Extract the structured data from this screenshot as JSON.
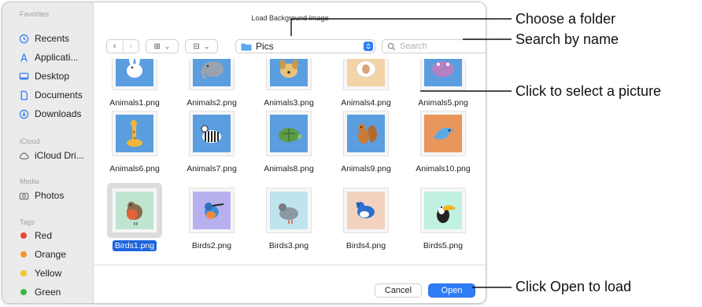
{
  "dialog": {
    "title": "Load Background Image",
    "sidebar": {
      "favorites_heading": "Favorites",
      "favorites": [
        {
          "label": "Recents",
          "icon": "clock-icon"
        },
        {
          "label": "Applicati...",
          "icon": "apps-icon"
        },
        {
          "label": "Desktop",
          "icon": "desktop-icon"
        },
        {
          "label": "Documents",
          "icon": "document-icon"
        },
        {
          "label": "Downloads",
          "icon": "download-icon"
        }
      ],
      "icloud_heading": "iCloud",
      "icloud": [
        {
          "label": "iCloud Dri...",
          "icon": "cloud-icon"
        }
      ],
      "media_heading": "Media",
      "media": [
        {
          "label": "Photos",
          "icon": "camera-icon"
        }
      ],
      "tags_heading": "Tags",
      "tags": [
        {
          "label": "Red",
          "color": "#e8483c"
        },
        {
          "label": "Orange",
          "color": "#f0952a"
        },
        {
          "label": "Yellow",
          "color": "#f3c823"
        },
        {
          "label": "Green",
          "color": "#3bb54a"
        }
      ]
    },
    "toolbar": {
      "location": "Pics",
      "search_placeholder": "Search"
    },
    "files": [
      {
        "name": "Animals1.png",
        "bg": "#5b9ee0",
        "icon": "rabbit-icon"
      },
      {
        "name": "Animals2.png",
        "bg": "#5b9ee0",
        "icon": "elephant-icon"
      },
      {
        "name": "Animals3.png",
        "bg": "#5b9ee0",
        "icon": "dog-icon"
      },
      {
        "name": "Animals4.png",
        "bg": "#f3d3a8",
        "icon": "sheep-icon"
      },
      {
        "name": "Animals5.png",
        "bg": "#5b9ee0",
        "icon": "hippo-icon"
      },
      {
        "name": "Animals6.png",
        "bg": "#5b9ee0",
        "icon": "giraffe-icon"
      },
      {
        "name": "Animals7.png",
        "bg": "#5b9ee0",
        "icon": "zebra-icon"
      },
      {
        "name": "Animals8.png",
        "bg": "#5b9ee0",
        "icon": "turtle-icon"
      },
      {
        "name": "Animals9.png",
        "bg": "#5b9ee0",
        "icon": "squirrel-icon"
      },
      {
        "name": "Animals10.png",
        "bg": "#e8965a",
        "icon": "dolphin-icon"
      },
      {
        "name": "Birds1.png",
        "bg": "#bfe4cf",
        "icon": "robin-icon",
        "selected": true
      },
      {
        "name": "Birds2.png",
        "bg": "#b6b0ee",
        "icon": "kingfisher-icon"
      },
      {
        "name": "Birds3.png",
        "bg": "#bfe4ee",
        "icon": "pigeon-icon"
      },
      {
        "name": "Birds4.png",
        "bg": "#f3d3bf",
        "icon": "bluejay-icon"
      },
      {
        "name": "Birds5.png",
        "bg": "#bff0e0",
        "icon": "toucan-icon"
      }
    ],
    "buttons": {
      "cancel": "Cancel",
      "open": "Open"
    }
  },
  "callouts": {
    "folder": "Choose a folder",
    "search": "Search by name",
    "select": "Click to select a picture",
    "open": "Click Open to load"
  }
}
